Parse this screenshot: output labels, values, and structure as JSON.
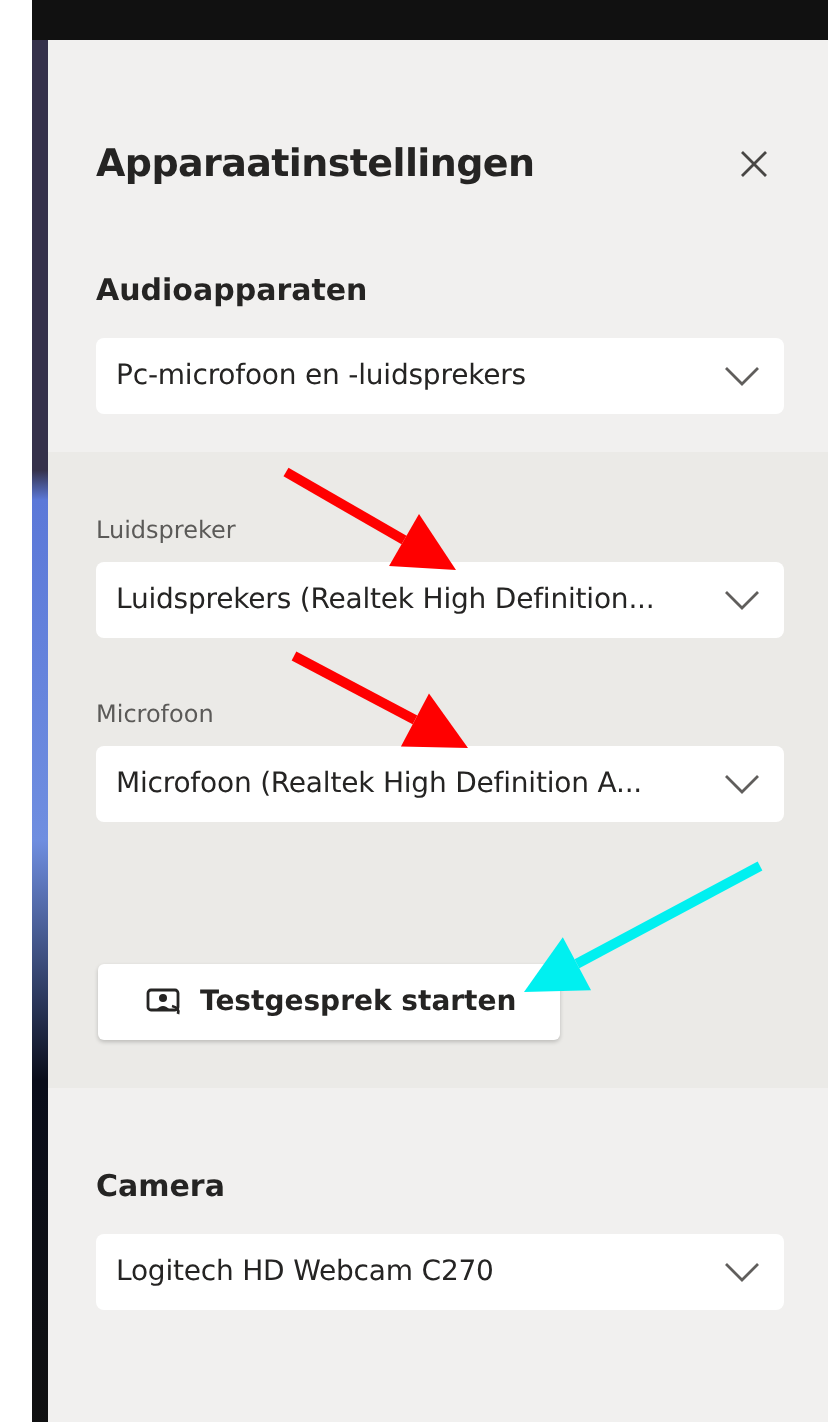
{
  "panel": {
    "title": "Apparaatinstellingen",
    "sections": [
      {
        "kind": "plain",
        "heading": "Audioapparaten",
        "dropdowns": [
          {
            "value": "Pc-microfoon en -luidsprekers"
          }
        ]
      },
      {
        "kind": "shaded",
        "dropdowns": [
          {
            "label": "Luidspreker",
            "value": "Luidsprekers (Realtek High Definition..."
          },
          {
            "label": "Microfoon",
            "value": "Microfoon (Realtek High Definition A..."
          }
        ],
        "button": {
          "label": "Testgesprek starten"
        }
      },
      {
        "kind": "plain",
        "heading": "Camera",
        "dropdowns": [
          {
            "value": "Logitech HD Webcam C270"
          }
        ]
      }
    ]
  },
  "annotations": [
    {
      "kind": "arrow",
      "color": "#ff0000"
    },
    {
      "kind": "arrow",
      "color": "#ff0000"
    },
    {
      "kind": "arrow",
      "color": "#00f0f0"
    }
  ]
}
